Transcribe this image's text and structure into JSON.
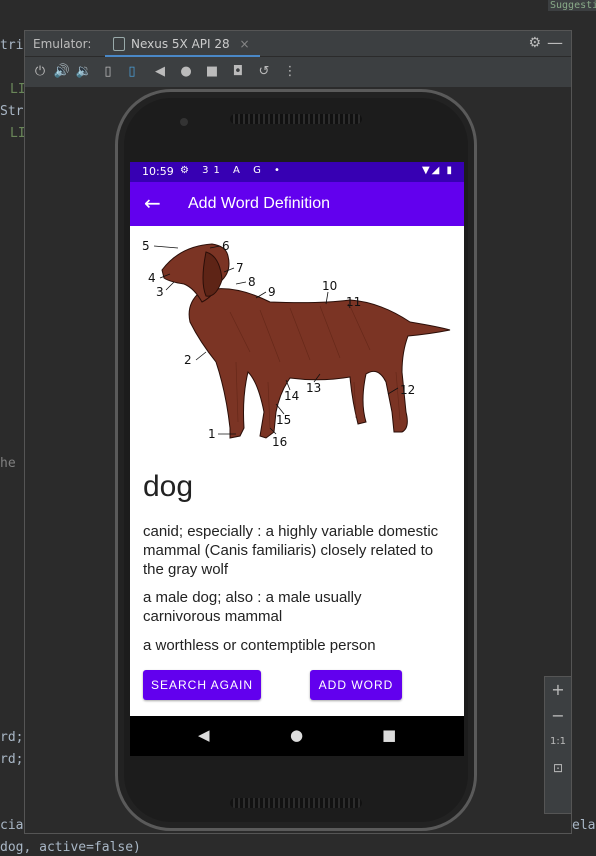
{
  "ide": {
    "code_lines": [
      "tri",
      "LI",
      "Str",
      "LI",
      "he",
      "rd;",
      "rd;",
      "cia",
      "dog, active=false)"
    ],
    "right_fragments": [
      "Suggesti",
      "elat"
    ]
  },
  "emulator": {
    "title_label": "Emulator:",
    "tab_label": "Nexus 5X API 28",
    "tab_close": "×"
  },
  "toolbar_icons": [
    "power-icon",
    "volume-up-icon",
    "volume-down-icon",
    "rotate-left-icon",
    "rotate-right-icon",
    "back-icon",
    "home-icon",
    "overview-icon",
    "camera-icon",
    "snapshot-icon",
    "more-icon"
  ],
  "phone": {
    "status": {
      "time": "10:59",
      "icons": "⚙ 31 A G •",
      "right": "▼◢ ▮"
    },
    "appbar": {
      "title": "Add Word Definition",
      "back_glyph": "←"
    },
    "word": "dog",
    "definitions": [
      "canid; especially : a highly variable domestic mammal (Canis familiaris) closely related to the gray wolf",
      "a male dog; also : a male usually carnivorous mammal",
      "a worthless or contemptible person"
    ],
    "buttons": {
      "search_again": "SEARCH AGAIN",
      "add_word": "ADD WORD"
    },
    "image_labels": [
      "5",
      "6",
      "4",
      "3",
      "7",
      "8",
      "9",
      "10",
      "11",
      "2",
      "14",
      "13",
      "12",
      "15",
      "1",
      "16"
    ]
  },
  "side_tools": {
    "zoom_in": "+",
    "zoom_out": "−",
    "one_to_one": "1:1"
  },
  "colors": {
    "primary": "#6200ee",
    "primary_dark": "#3700b3",
    "dog_fur": "#7b3424"
  }
}
